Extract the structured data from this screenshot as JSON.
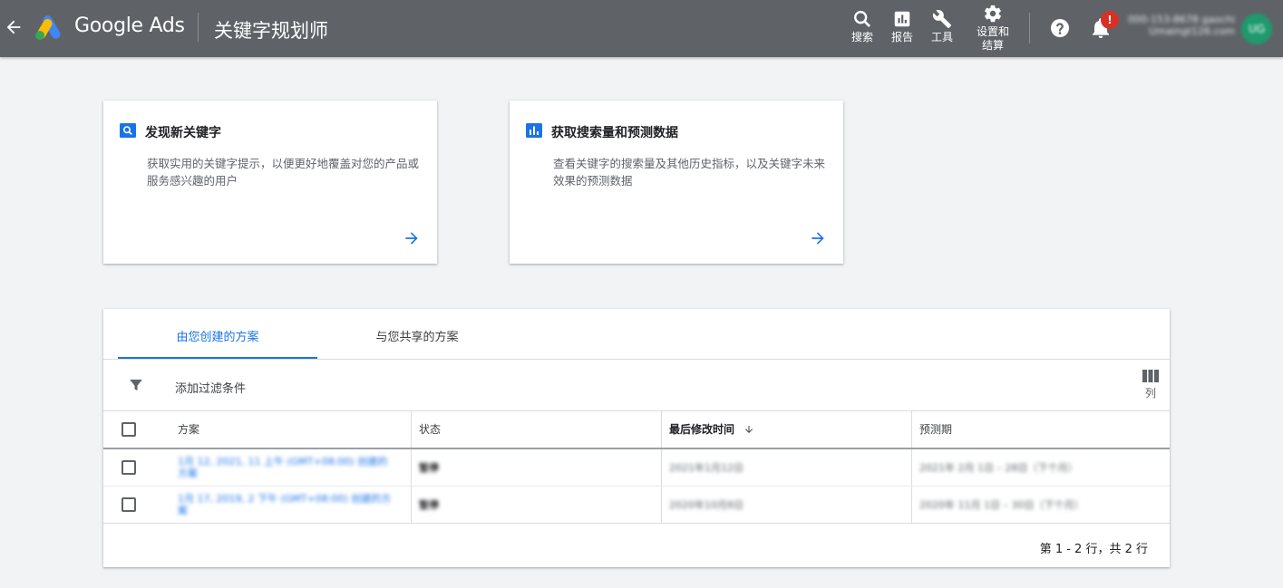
{
  "header": {
    "brand": "Google Ads",
    "page_title": "关键字规划师",
    "nav": [
      {
        "label": "搜索",
        "icon": "search-icon"
      },
      {
        "label": "报告",
        "icon": "report-icon"
      },
      {
        "label": "工具",
        "icon": "wrench-icon"
      },
      {
        "label_line1": "设置和",
        "label_line2": "结算",
        "icon": "gear-icon"
      }
    ],
    "notification_badge": "!",
    "account_id": "000-153-8678 gaochi",
    "account_email": "Umaingt126.com",
    "avatar_text": "UG"
  },
  "cards": [
    {
      "icon": "search-box-icon",
      "title": "发现新关键字",
      "description": "获取实用的关键字提示，以便更好地覆盖对您的产品或服务感兴趣的用户"
    },
    {
      "icon": "bar-chart-icon",
      "title": "获取搜索量和预测数据",
      "description": "查看关键字的搜索量及其他历史指标，以及关键字未来效果的预测数据"
    }
  ],
  "plans": {
    "tabs": [
      {
        "label": "由您创建的方案",
        "active": true
      },
      {
        "label": "与您共享的方案",
        "active": false
      }
    ],
    "filter_label": "添加过滤条件",
    "columns_label": "列",
    "headers": {
      "plan": "方案",
      "status": "状态",
      "last_modified": "最后修改时间",
      "forecast": "预测期"
    },
    "rows": [
      {
        "plan_line1": "1月 12, 2021, 11 上午 (GMT+08:00) 创建的",
        "plan_line2": "方案",
        "status": "暂停",
        "last_modified": "2021年1月12日",
        "forecast": "2021年 2月 1日 – 28日（下个月）"
      },
      {
        "plan_line1": "1月 17, 2019, 2 下午 (GMT+08:00) 创建的方",
        "plan_line2": "案",
        "status": "暂停",
        "last_modified": "2020年10月8日",
        "forecast": "2020年 11月 1日 – 30日（下个月）"
      }
    ],
    "pagination": "第 1 - 2 行，共 2 行"
  },
  "colors": {
    "topbar": "#5f6368",
    "accent": "#1a73e8",
    "badge": "#d93025"
  }
}
